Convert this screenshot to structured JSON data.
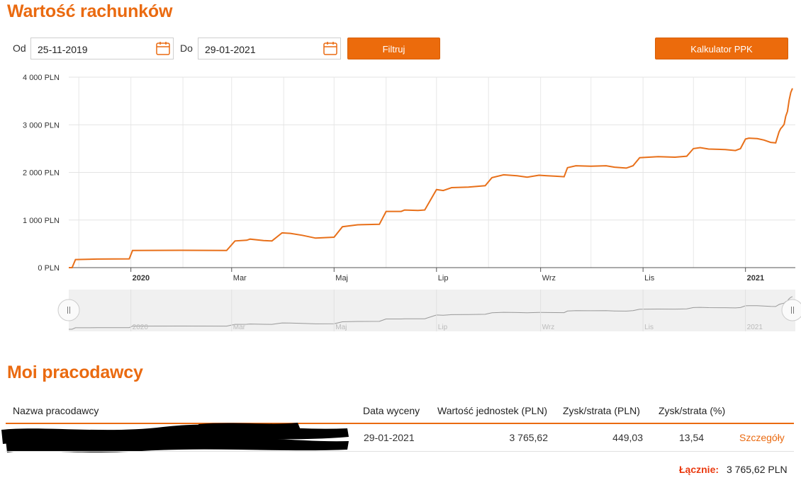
{
  "accounts_title": "Wartość rachunków",
  "filter": {
    "from_label": "Od",
    "from_value": "25-11-2019",
    "to_label": "Do",
    "to_value": "29-01-2021",
    "filter_button": "Filtruj",
    "calculator_button": "Kalkulator PPK"
  },
  "colors": {
    "accent": "#ea6a10",
    "line": "#e8701a"
  },
  "chart_data": {
    "type": "line",
    "title": "",
    "xlabel": "",
    "ylabel": "",
    "x_tick_labels": [
      "2020",
      "Mar",
      "Maj",
      "Lip",
      "Wrz",
      "Lis",
      "2021"
    ],
    "y_tick_labels": [
      "0 PLN",
      "1 000 PLN",
      "2 000 PLN",
      "3 000 PLN",
      "4 000 PLN"
    ],
    "ylim": [
      0,
      4000
    ],
    "xlim": [
      "2019-11-25",
      "2021-01-29"
    ],
    "grid": true,
    "series": [
      {
        "values": [
          [
            "2019-11-25",
            0
          ],
          [
            "2019-11-27",
            0
          ],
          [
            "2019-11-29",
            170
          ],
          [
            "2019-12-12",
            180
          ],
          [
            "2019-12-31",
            185
          ],
          [
            "2020-01-02",
            360
          ],
          [
            "2020-01-31",
            365
          ],
          [
            "2020-02-27",
            360
          ],
          [
            "2020-03-03",
            560
          ],
          [
            "2020-03-10",
            575
          ],
          [
            "2020-03-12",
            600
          ],
          [
            "2020-03-20",
            570
          ],
          [
            "2020-03-25",
            560
          ],
          [
            "2020-03-31",
            730
          ],
          [
            "2020-04-05",
            720
          ],
          [
            "2020-04-12",
            680
          ],
          [
            "2020-04-20",
            620
          ],
          [
            "2020-05-01",
            640
          ],
          [
            "2020-05-06",
            860
          ],
          [
            "2020-05-15",
            900
          ],
          [
            "2020-05-28",
            910
          ],
          [
            "2020-06-01",
            1180
          ],
          [
            "2020-06-10",
            1180
          ],
          [
            "2020-06-12",
            1210
          ],
          [
            "2020-06-20",
            1200
          ],
          [
            "2020-06-24",
            1210
          ],
          [
            "2020-07-01",
            1640
          ],
          [
            "2020-07-05",
            1620
          ],
          [
            "2020-07-10",
            1680
          ],
          [
            "2020-07-20",
            1690
          ],
          [
            "2020-07-30",
            1720
          ],
          [
            "2020-08-03",
            1890
          ],
          [
            "2020-08-10",
            1950
          ],
          [
            "2020-08-18",
            1930
          ],
          [
            "2020-08-24",
            1900
          ],
          [
            "2020-08-31",
            1940
          ],
          [
            "2020-09-05",
            1930
          ],
          [
            "2020-09-10",
            1920
          ],
          [
            "2020-09-15",
            1910
          ],
          [
            "2020-09-17",
            2100
          ],
          [
            "2020-09-22",
            2140
          ],
          [
            "2020-10-01",
            2130
          ],
          [
            "2020-10-10",
            2140
          ],
          [
            "2020-10-15",
            2110
          ],
          [
            "2020-10-22",
            2090
          ],
          [
            "2020-10-26",
            2140
          ],
          [
            "2020-10-30",
            2310
          ],
          [
            "2020-11-10",
            2330
          ],
          [
            "2020-11-20",
            2320
          ],
          [
            "2020-11-27",
            2340
          ],
          [
            "2020-12-01",
            2500
          ],
          [
            "2020-12-05",
            2520
          ],
          [
            "2020-12-10",
            2490
          ],
          [
            "2020-12-20",
            2480
          ],
          [
            "2020-12-26",
            2460
          ],
          [
            "2020-12-29",
            2500
          ],
          [
            "2021-01-01",
            2700
          ],
          [
            "2021-01-03",
            2720
          ],
          [
            "2021-01-08",
            2710
          ],
          [
            "2021-01-12",
            2680
          ],
          [
            "2021-01-16",
            2630
          ],
          [
            "2021-01-19",
            2620
          ],
          [
            "2021-01-21",
            2850
          ],
          [
            "2021-01-22",
            2920
          ],
          [
            "2021-01-23",
            2960
          ],
          [
            "2021-01-24",
            3010
          ],
          [
            "2021-01-25",
            3180
          ],
          [
            "2021-01-26",
            3280
          ],
          [
            "2021-01-27",
            3520
          ],
          [
            "2021-01-28",
            3680
          ],
          [
            "2021-01-29",
            3765
          ]
        ]
      }
    ]
  },
  "navigator": {
    "labels": [
      "2020",
      "Mar",
      "Maj",
      "Lip",
      "Wrz",
      "Lis",
      "2021"
    ]
  },
  "employers": {
    "title": "Moi pracodawcy",
    "columns": [
      "Nazwa pracodawcy",
      "Data wyceny",
      "Wartość jednostek (PLN)",
      "Zysk/strata (PLN)",
      "Zysk/strata (%)"
    ],
    "rows": [
      {
        "date": "29-01-2021",
        "value": "3 765,62",
        "profit": "449,03",
        "profit_pct": "13,54",
        "details_link": "Szczegóły"
      }
    ],
    "total_label": "Łącznie:",
    "total_value": "3 765,62 PLN"
  }
}
